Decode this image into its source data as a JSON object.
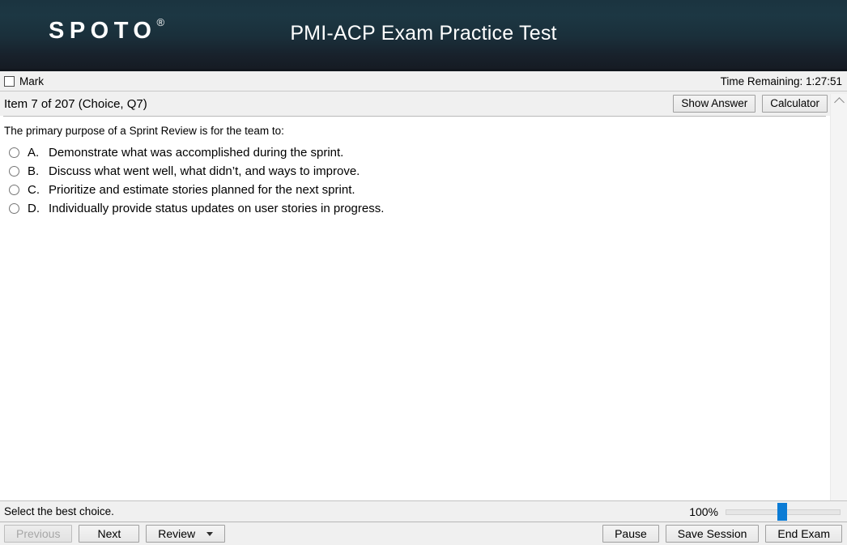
{
  "banner": {
    "logo_text": "SPOTO",
    "logo_registered_mark": "®",
    "title": "PMI-ACP Exam Practice Test"
  },
  "mark_bar": {
    "mark_label": "Mark",
    "mark_checked": false,
    "timer_label": "Time Remaining: 1:27:51"
  },
  "item_bar": {
    "item_title": "Item 7 of 207 (Choice, Q7)",
    "show_answer_label": "Show Answer",
    "calculator_label": "Calculator"
  },
  "question": {
    "stem": "The primary purpose of a Sprint Review is for the team to:",
    "options": [
      {
        "letter": "A.",
        "text": "Demonstrate what was accomplished during the sprint.",
        "selected": false
      },
      {
        "letter": "B.",
        "text": "Discuss what went well, what didn’t, and ways to improve.",
        "selected": false
      },
      {
        "letter": "C.",
        "text": "Prioritize and estimate stories planned for the next sprint.",
        "selected": false
      },
      {
        "letter": "D.",
        "text": "Individually provide status updates on user stories in progress.",
        "selected": false
      }
    ]
  },
  "status_bar": {
    "status_text": "Select the best choice.",
    "zoom_percent": "100%"
  },
  "toolbar": {
    "previous_label": "Previous",
    "previous_disabled": true,
    "next_label": "Next",
    "review_label": "Review",
    "pause_label": "Pause",
    "save_session_label": "Save Session",
    "end_exam_label": "End Exam"
  },
  "colors": {
    "banner_top": "#1b3440",
    "banner_bottom": "#151a22",
    "slider_thumb": "#0c7cd5",
    "chrome": "#f0f0f0"
  }
}
